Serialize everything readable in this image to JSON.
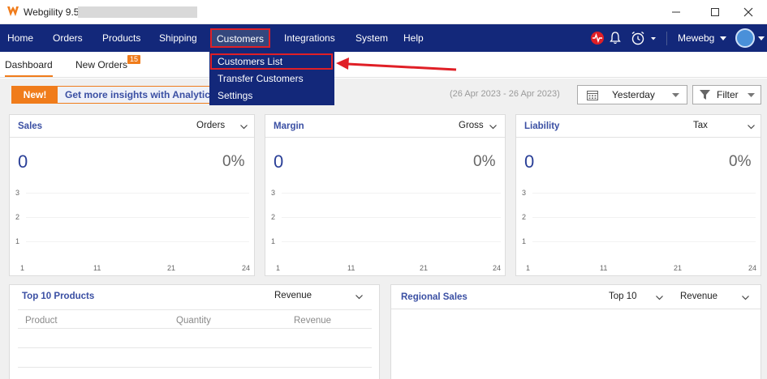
{
  "window": {
    "title": "Webgility 9.5"
  },
  "menu": {
    "items": [
      "Home",
      "Orders",
      "Products",
      "Shipping",
      "Customers",
      "Integrations",
      "System",
      "Help"
    ],
    "user": "Mewebg"
  },
  "customers_dropdown": {
    "items": [
      "Customers List",
      "Transfer Customers",
      "Settings"
    ]
  },
  "tabs": {
    "dashboard": "Dashboard",
    "new_orders": "New Orders",
    "new_orders_badge": "15"
  },
  "banner": {
    "badge": "New!",
    "text": "Get more insights with Analytics"
  },
  "filters": {
    "date_range": "(26 Apr 2023 - 26 Apr 2023)",
    "period": "Yesterday",
    "filter_label": "Filter"
  },
  "cards": {
    "sales": {
      "title": "Sales",
      "dropdown": "Orders",
      "value": "0",
      "percent": "0%"
    },
    "margin": {
      "title": "Margin",
      "dropdown": "Gross",
      "value": "0",
      "percent": "0%"
    },
    "liability": {
      "title": "Liability",
      "dropdown": "Tax",
      "value": "0",
      "percent": "0%"
    }
  },
  "chart_axis": {
    "y_ticks": [
      "3",
      "2",
      "1"
    ],
    "x_ticks": [
      "1",
      "11",
      "21",
      "24"
    ]
  },
  "top_products": {
    "title": "Top 10 Products",
    "dropdown": "Revenue",
    "columns": [
      "Product",
      "Quantity",
      "Revenue"
    ]
  },
  "regional_sales": {
    "title": "Regional Sales",
    "dropdown_top": "Top 10",
    "dropdown_metric": "Revenue"
  },
  "colors": {
    "navy": "#13287a",
    "accent_orange": "#f07c1b",
    "highlight_red": "#e01f26",
    "title_blue": "#3a4fa3"
  }
}
